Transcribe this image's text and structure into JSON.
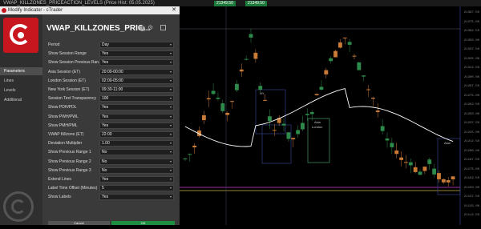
{
  "window": {
    "title": "VWAP_KILLZONES_PRICEACTION_LEVELS  (Price Hist: 05.05.2025)",
    "price_bid": "21349.50",
    "price_ask": "21349.50"
  },
  "dialog": {
    "title": "Modify Indicator - cTrader",
    "close_glyph": "✕",
    "indicator_name": "VWAP_KILLZONES_PRIC...",
    "nav": [
      {
        "label": "Parameters",
        "active": true
      },
      {
        "label": "Lines",
        "active": false
      },
      {
        "label": "Levels",
        "active": false
      },
      {
        "label": "Additional",
        "active": false
      }
    ],
    "fields": [
      {
        "label": "Period",
        "value": "Day"
      },
      {
        "label": "Show Session Range",
        "value": "Yes"
      },
      {
        "label": "Show Session Previous Ran...",
        "value": "Yes"
      },
      {
        "label": "Asia Session (ET)",
        "value": "20:00-00:00"
      },
      {
        "label": "London Session (ET)",
        "value": "02:00-05:00"
      },
      {
        "label": "New York Session (ET)",
        "value": "09:30-11:00"
      },
      {
        "label": "Session Text Transparency",
        "value": "100"
      },
      {
        "label": "Show PDH/PDL",
        "value": "Yes"
      },
      {
        "label": "Show PWH/PWL",
        "value": "Yes"
      },
      {
        "label": "Show PMH/PML",
        "value": "Yes"
      },
      {
        "label": "VWAP Killzone (ET)",
        "value": "22:00"
      },
      {
        "label": "Deviation Multiplier",
        "value": "1.00"
      },
      {
        "label": "Show Previous Range 1",
        "value": "No"
      },
      {
        "label": "Show Previous Range 2",
        "value": "No"
      },
      {
        "label": "Show Previous Range 3",
        "value": "No"
      },
      {
        "label": "Extend Lines",
        "value": "Yes"
      },
      {
        "label": "Label Time Offset (Minutes)",
        "value": "5"
      },
      {
        "label": "Show Labels",
        "value": "Yes"
      }
    ],
    "cancel_label": "Cancel",
    "ok_label": "OK"
  },
  "chart": {
    "price_labels": [
      "21387.50",
      "21375.00",
      "21362.50",
      "21350.00",
      "21337.50",
      "21325.00",
      "21312.50",
      "21300.00",
      "21287.50",
      "21275.00",
      "21262.50",
      "21250.00",
      "21237.50",
      "21225.00",
      "21212.50",
      "21200.00",
      "21187.50",
      "21175.00",
      "21162.50",
      "21150.00",
      "21137.50",
      "21125.00",
      "21112.50"
    ],
    "box_labels": [
      "NY",
      "Asia",
      "London",
      "Asia"
    ],
    "colors": {
      "bull": "#c97a37",
      "bear": "#2d8a4a",
      "vwap": "#ffffff",
      "pdh": "#d63ad6",
      "pdl": "#c8b34c",
      "session_box": "#3a4a9a",
      "session_box_green": "#3f9a3f",
      "axis_line": "#3a4a9a"
    }
  }
}
